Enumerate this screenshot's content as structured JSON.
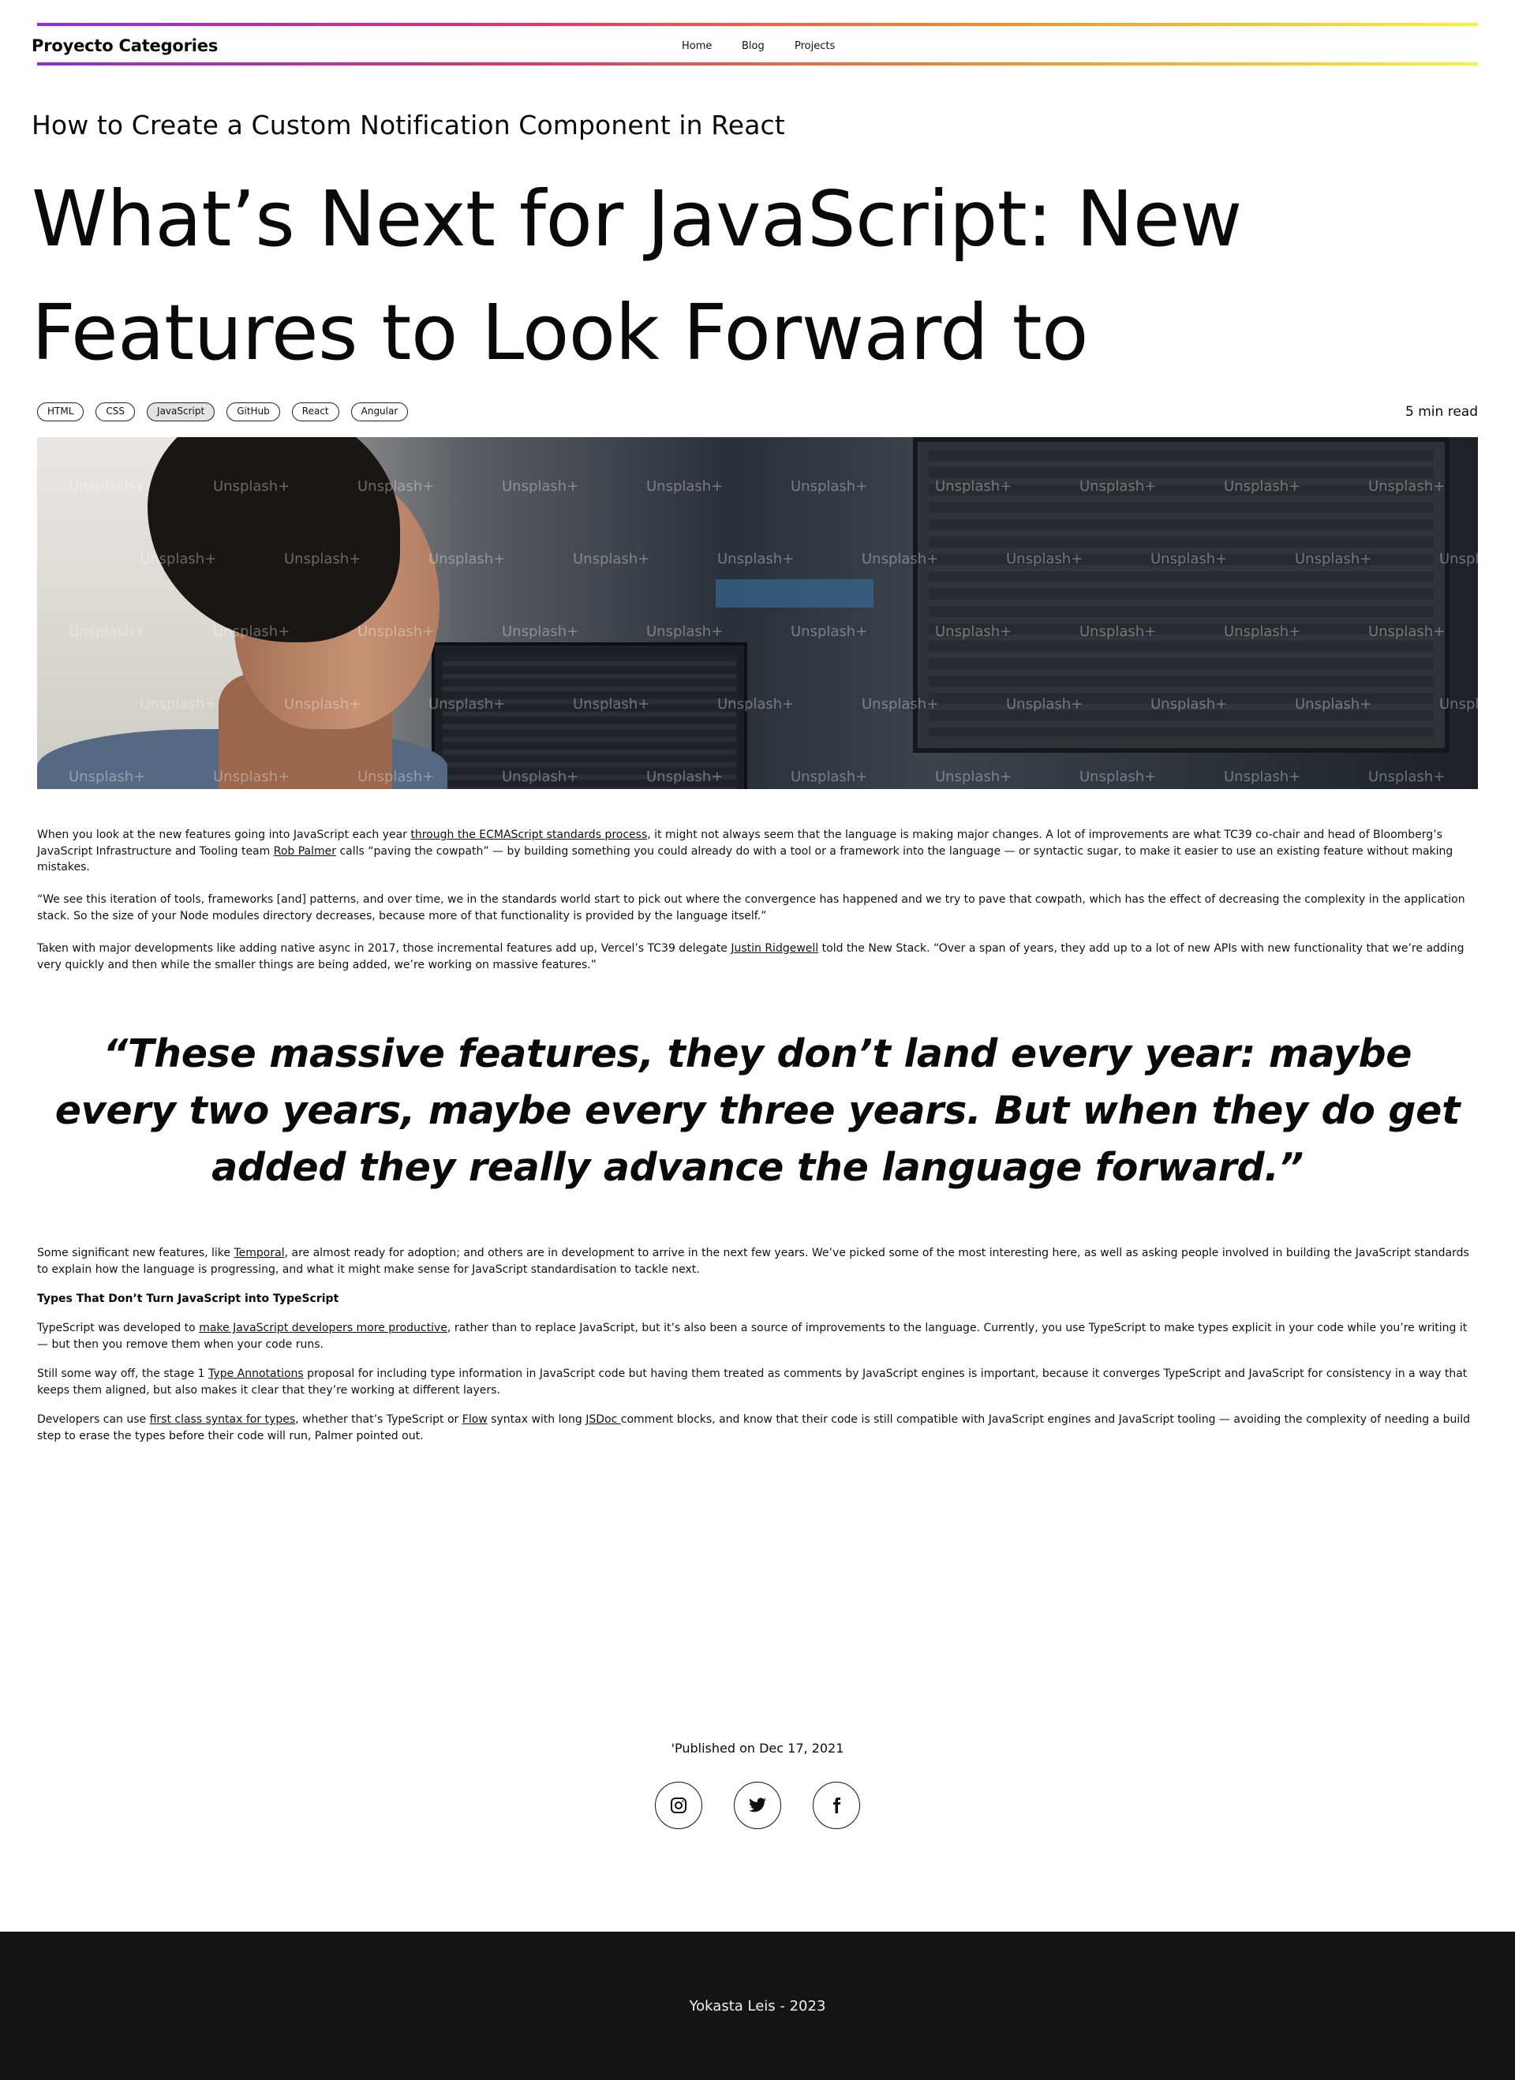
{
  "header": {
    "brand": "Proyecto Categories",
    "nav": [
      "Home",
      "Blog",
      "Projects"
    ]
  },
  "article": {
    "subtitle": "How to Create a Custom Notification Component in React",
    "title": "What’s Next for JavaScript: New Features to Look Forward to",
    "tags": [
      "HTML",
      "CSS",
      "JavaScript",
      "GitHub",
      "React",
      "Angular"
    ],
    "active_tag": "JavaScript",
    "read_time": "5 min read",
    "hero_watermark": "Unsplash+",
    "p1": {
      "a": "When you look at the new features going into JavaScript each year ",
      "link1": "through the ECMAScript standards process",
      "b": ", it might not always seem that the language is making major changes. A lot of improvements are what TC39 co-chair and head of Bloomberg’s JavaScript Infrastructure and Tooling team ",
      "link2": "Rob Palmer",
      "c": " calls “paving the cowpath” — by building something you could already do with a tool or a framework into the language — or syntactic sugar, to make it easier to use an existing feature without making mistakes."
    },
    "p2": "“We see this iteration of tools, frameworks [and] patterns, and over time, we in the standards world start to pick out where the convergence has happened and we try to pave that cowpath, which has the effect of decreasing the complexity in the application stack. So the size of your Node modules directory decreases, because more of that functionality is provided by the language itself.”",
    "p3": {
      "a": "Taken with major developments like adding native async in 2017, those incremental features add up, Vercel’s TC39 delegate ",
      "link": "Justin Ridgewell",
      "b": " told the New Stack. “Over a span of years, they add up to a lot of new APIs with new functionality that we’re adding very quickly and then while the smaller things are being added, we’re working on massive features.”"
    },
    "quote": "“These massive features, they don’t land every year: maybe every two years, maybe every three years. But when they do get added they really advance the language forward.”",
    "p4": {
      "a": "Some significant new features, like ",
      "link": "Temporal",
      "b": ", are almost ready for adoption; and others are in development to arrive in the next few years. We’ve picked some of the most interesting here, as well as asking people involved in building the JavaScript standards to explain how the language is progressing, and what it might make sense for JavaScript standardisation to tackle next."
    },
    "h4": "Types That Don’t Turn JavaScript into TypeScript",
    "p5": {
      "a": "TypeScript was developed to ",
      "link": "make JavaScript developers more productive",
      "b": ", rather than to replace JavaScript, but it’s also been a source of improvements to the language. Currently, you use TypeScript to make types explicit in your code while you’re writing it — but then you remove them when your code runs."
    },
    "p6": {
      "a": "Still some way off, the stage 1 ",
      "link": "Type Annotations",
      "b": " proposal for including type information in JavaScript code but having them treated as comments by JavaScript engines is important, because it converges TypeScript and JavaScript for consistency in a way that keeps them aligned, but also makes it clear that they’re working at different layers."
    },
    "p7": {
      "a": "Developers can use ",
      "link1": "first class syntax for types",
      "b": ", whether that’s TypeScript or ",
      "link2": "Flow",
      "c": " syntax with long ",
      "link3": "JSDoc ",
      "d": "comment blocks, and know that their code is still compatible with JavaScript engines and JavaScript tooling — avoiding the complexity of needing a build step to erase the types before their code will run, Palmer pointed out."
    },
    "published": "'Published on Dec 17, 2021"
  },
  "social": [
    "instagram-icon",
    "twitter-icon",
    "facebook-icon"
  ],
  "footer": {
    "text": "Yokasta Leis - 2023"
  },
  "colors": {
    "gradient": [
      "#8e2de2",
      "#e8306b",
      "#f28c28",
      "#f8f43a"
    ],
    "footer_bg": "#141414",
    "active_tag_bg": "#e3e3e3"
  }
}
